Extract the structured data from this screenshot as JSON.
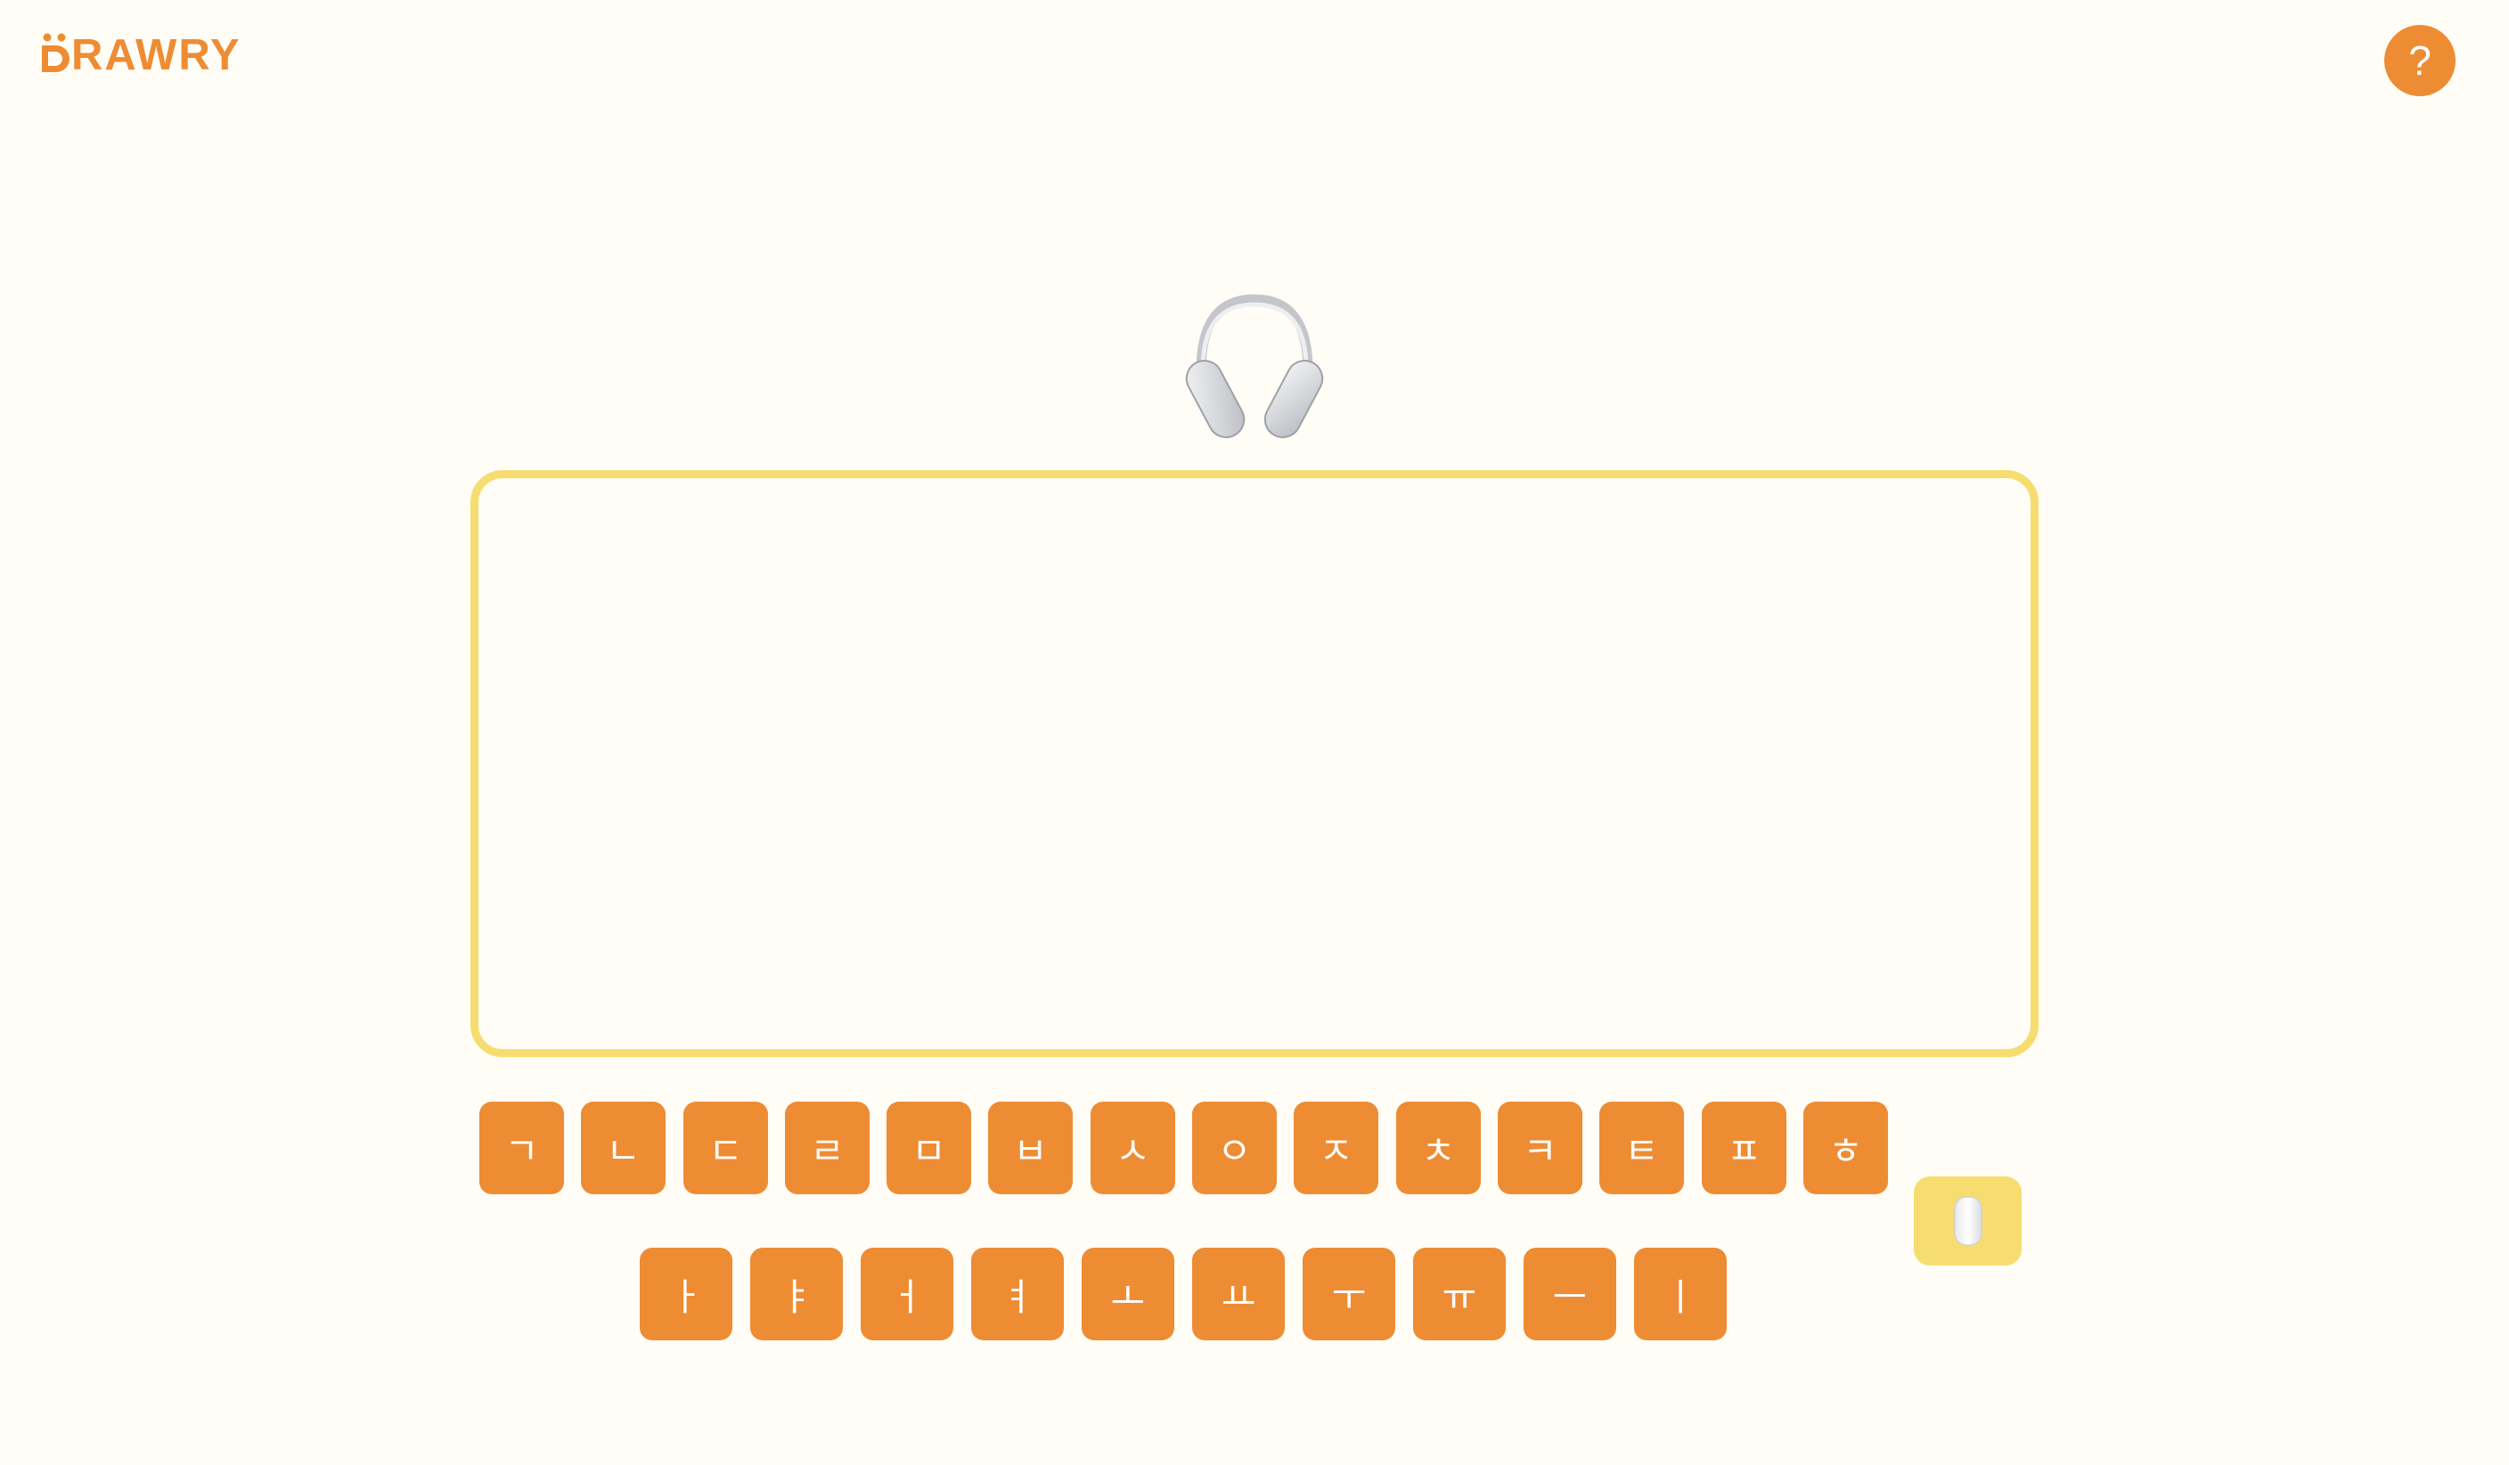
{
  "header": {
    "logo_text": "RAWRY",
    "help_label": "?"
  },
  "prompt": {
    "icon": "headphones-icon"
  },
  "keyboard": {
    "consonants": [
      "ㄱ",
      "ㄴ",
      "ㄷ",
      "ㄹ",
      "ㅁ",
      "ㅂ",
      "ㅅ",
      "ㅇ",
      "ㅈ",
      "ㅊ",
      "ㅋ",
      "ㅌ",
      "ㅍ",
      "ㅎ"
    ],
    "vowels": [
      "ㅏ",
      "ㅑ",
      "ㅓ",
      "ㅕ",
      "ㅗ",
      "ㅛ",
      "ㅜ",
      "ㅠ",
      "ㅡ",
      "ㅣ"
    ],
    "eraser_icon": "eraser-icon"
  },
  "colors": {
    "accent": "#ee8c34",
    "highlight": "#f7dc6f",
    "background": "#fffdf6"
  }
}
